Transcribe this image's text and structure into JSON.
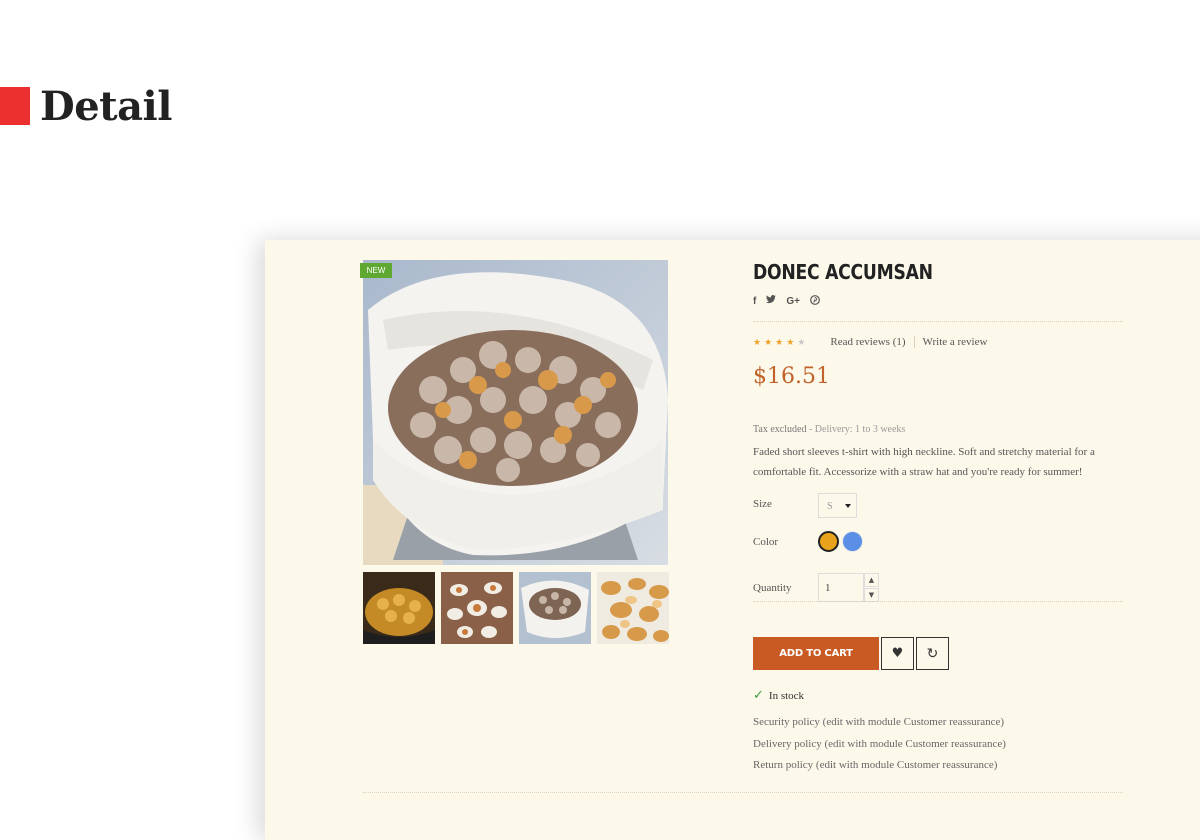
{
  "page_heading": "Detail",
  "product": {
    "badge": "NEW",
    "title": "DONEC ACCUMSAN",
    "social_icons": [
      "facebook-icon",
      "twitter-icon",
      "google-plus-icon",
      "pinterest-icon"
    ],
    "social_glyphs": {
      "facebook": "f",
      "twitter": "y",
      "google_plus": "G+",
      "pinterest": "p"
    },
    "rating": 4,
    "rating_max": 5,
    "read_reviews": "Read reviews (1)",
    "write_review": "Write a review",
    "price": "$16.51",
    "tax_text": "Tax excluded",
    "delivery_text": " - Delivery: 1 to 3 weeks",
    "description": "Faded short sleeves t-shirt with high neckline. Soft and stretchy material for a comfortable fit. Accessorize with a straw hat and you're ready for summer!",
    "size_label": "Size",
    "size_value": "S",
    "color_label": "Color",
    "colors": [
      "#e8a21b",
      "#5b8fe6"
    ],
    "quantity_label": "Quantity",
    "quantity_value": "1",
    "add_to_cart": "ADD TO CART",
    "stock_status": "In stock",
    "policies": [
      "Security policy (edit with module Customer reassurance)",
      "Delivery policy (edit with module Customer reassurance)",
      "Return policy (edit with module Customer reassurance)"
    ]
  },
  "colors": {
    "accent_red": "#ec2f2f",
    "price": "#c0622a",
    "cart_button": "#ca5a23",
    "badge_green": "#5fa832",
    "card_background": "#fcf9eb"
  }
}
